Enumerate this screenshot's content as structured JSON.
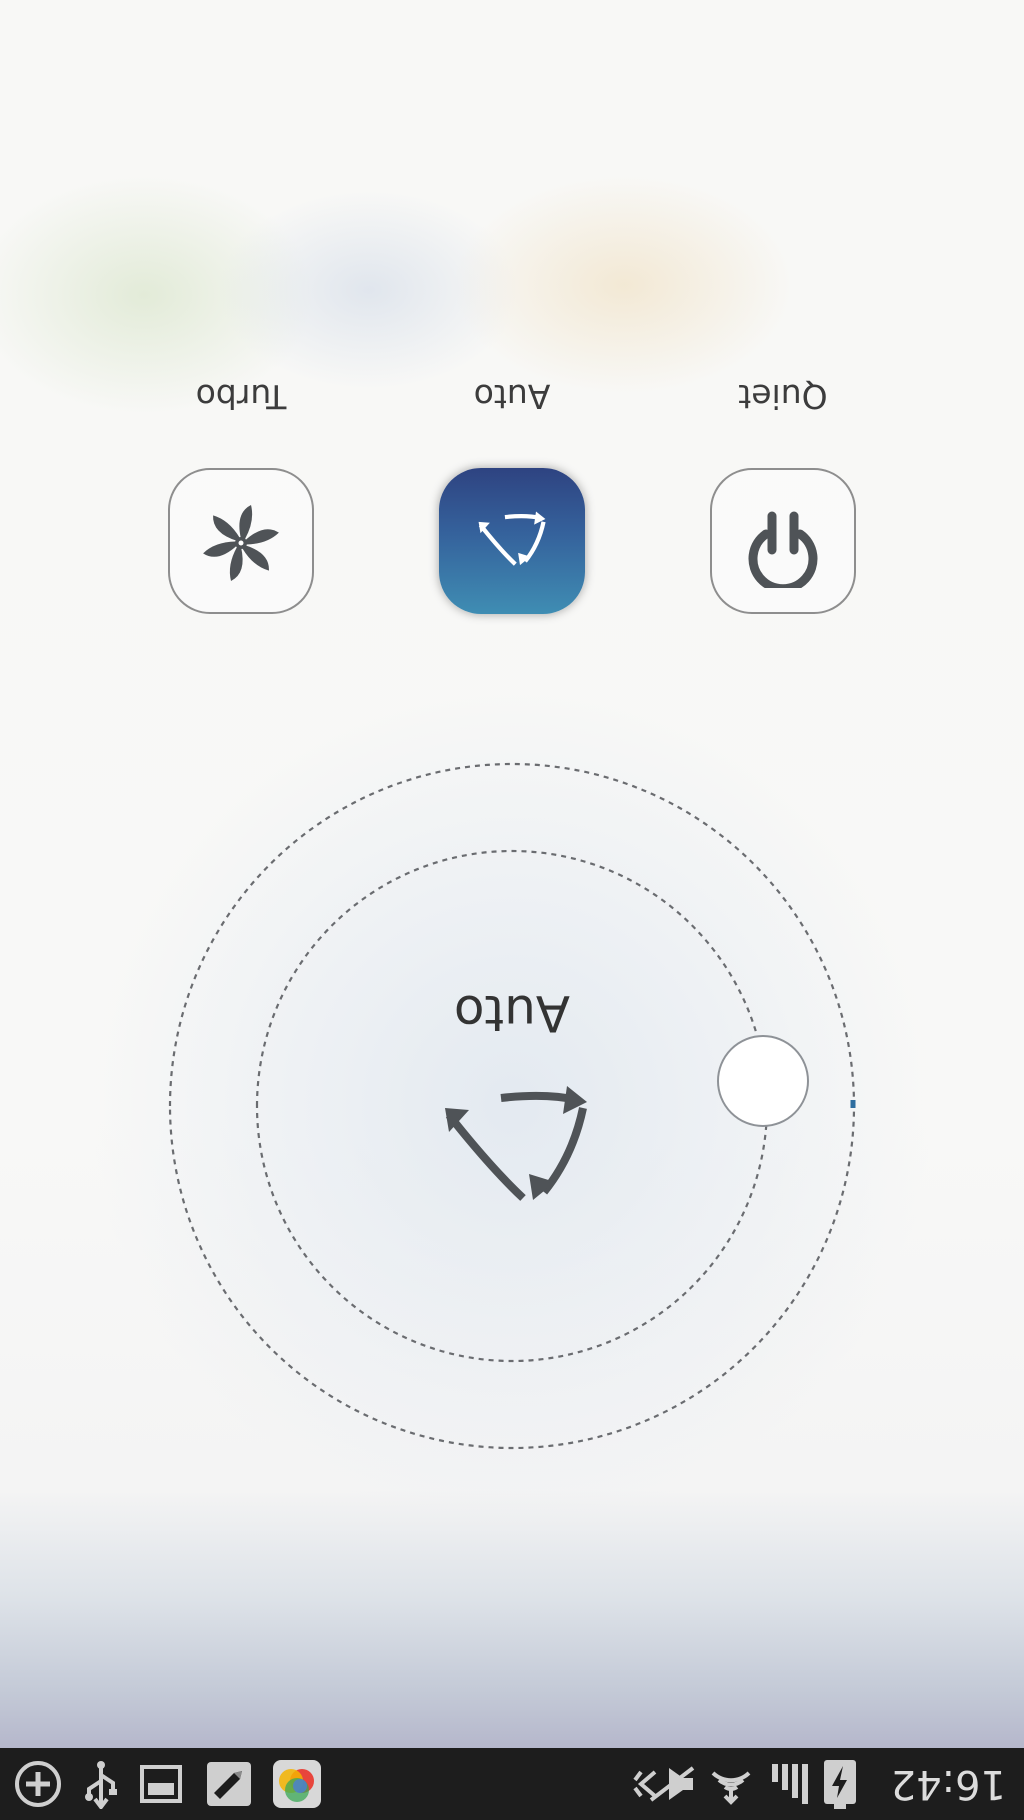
{
  "status_bar": {
    "time": "16:42",
    "icons": [
      "battery-charging-icon",
      "signal-icon",
      "wifi-icon",
      "mute-icon",
      "add-icon",
      "usb-icon",
      "gallery-icon",
      "pen-app-icon",
      "photos-app-icon"
    ]
  },
  "modes": [
    {
      "label": "Quiet",
      "icon": "power-icon",
      "selected": false
    },
    {
      "label": "Auto",
      "icon": "auto-cycle-icon",
      "selected": true
    },
    {
      "label": "Turbo",
      "icon": "fan-icon",
      "selected": false
    }
  ],
  "dial": {
    "mode_label": "Auto",
    "icon": "auto-cycle-icon"
  },
  "colors": {
    "accent_top": "#3f8db3",
    "accent_bottom": "#2e4381",
    "status_bar": "#1d1d1d"
  }
}
